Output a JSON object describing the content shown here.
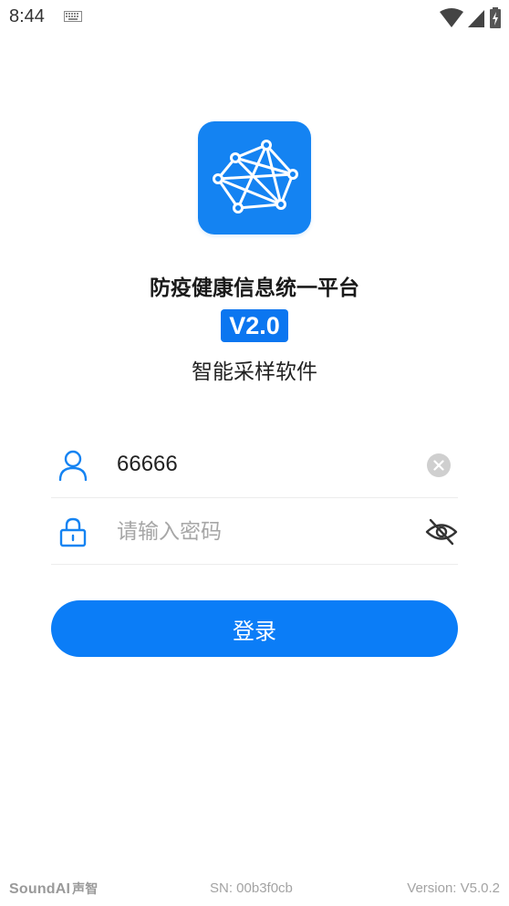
{
  "status_bar": {
    "time": "8:44"
  },
  "app": {
    "title": "防疫健康信息统一平台",
    "version_badge": "V2.0",
    "subtitle": "智能采样软件"
  },
  "form": {
    "username_value": "66666",
    "password_placeholder": "请输入密码",
    "login_label": "登录"
  },
  "footer": {
    "brand": "SoundAI",
    "brand_zh": "声智",
    "sn": "SN: 00b3f0cb",
    "version": "Version: V5.0.2"
  },
  "colors": {
    "primary": "#0b7df7",
    "logo_bg": "#1483f2"
  }
}
